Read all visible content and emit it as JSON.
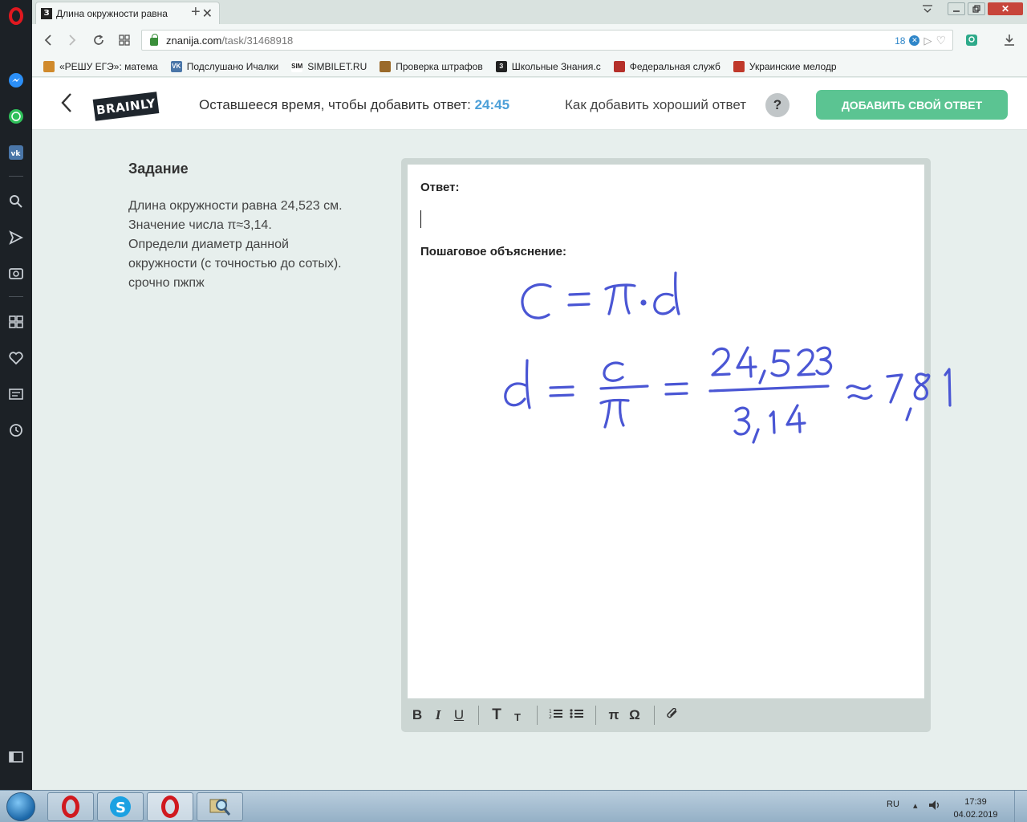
{
  "browser": {
    "tab_title": "Длина окружности равна",
    "favicon": "З",
    "new_tab": "+",
    "url_domain": "znanija.com",
    "url_path": "/task/31468918",
    "adblock_count": "18",
    "bookmarks": [
      {
        "label": "«РЕШУ ЕГЭ»: матема",
        "icon_color": "#d08a2c",
        "icon_text": ""
      },
      {
        "label": "Подслушано Ичалки",
        "icon_color": "#4a76a8",
        "icon_text": "VK"
      },
      {
        "label": "SIMBILET.RU",
        "icon_color": "#ffffff",
        "icon_text": "SIM"
      },
      {
        "label": "Проверка штрафов",
        "icon_color": "#9a6a2a",
        "icon_text": ""
      },
      {
        "label": "Школьные Знания.с",
        "icon_color": "#222222",
        "icon_text": "З"
      },
      {
        "label": "Федеральная служб",
        "icon_color": "#b5302a",
        "icon_text": ""
      },
      {
        "label": "Украинские мелодр",
        "icon_color": "#c0392b",
        "icon_text": ""
      }
    ]
  },
  "header": {
    "logo": "BRAINLY",
    "timer_label": "Оставшееся время, чтобы добавить ответ:",
    "timer_value": "24:45",
    "how_to": "Как добавить хороший ответ",
    "help": "?",
    "add_answer": "ДОБАВИТЬ СВОЙ ОТВЕТ"
  },
  "task": {
    "heading": "Задание",
    "lines": [
      "Длина окружности равна 24,523 см.",
      "Значение числа π≈3,14.",
      "Определи диаметр данной",
      "окружности (с точностью до сотых).",
      "срочно пжпж"
    ]
  },
  "editor": {
    "answer_label": "Ответ:",
    "explain_label": "Пошаговое объяснение:",
    "handwriting": {
      "line1": "C = π · d",
      "line2_lhs": "d =",
      "fraction1_num": "c",
      "fraction1_den": "π",
      "fraction2_num": "24,523",
      "fraction2_den": "3,14",
      "approx": "≈",
      "result": "7,81",
      "ink_color": "#4a56d4"
    },
    "toolbar": {
      "bold": "B",
      "italic": "I",
      "underline": "U",
      "text_large": "T",
      "text_small": "T",
      "ordered_list": "≡",
      "bullet_list": "☰",
      "pi": "π",
      "omega": "Ω",
      "attach": "⊘"
    }
  },
  "taskbar": {
    "lang": "RU",
    "time": "17:39",
    "date": "04.02.2019"
  },
  "colors": {
    "accent_green": "#5bc492",
    "timer_blue": "#4b9fd8"
  }
}
